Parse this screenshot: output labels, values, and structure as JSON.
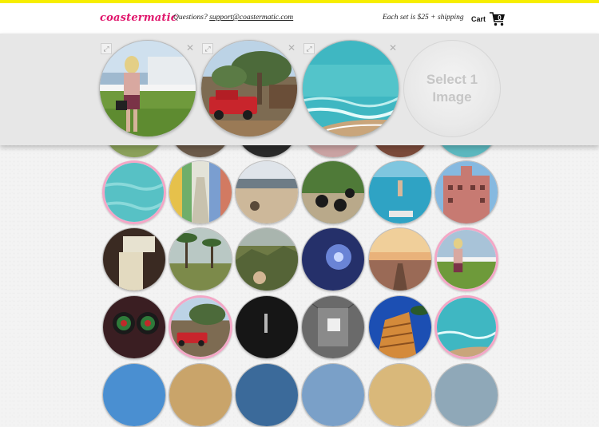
{
  "header": {
    "logo": "coastermatic",
    "questions_label": "Questions?",
    "email": "support@coastermatic.com",
    "pricing": "Each set is $25 + shipping",
    "cart_label": "Cart",
    "cart_count": "0"
  },
  "tray": {
    "empty_slot_text_line1": "Select 1",
    "empty_slot_text_line2": "Image",
    "slots": [
      {
        "image": "girl-by-fence",
        "expand_icon": "expand-icon",
        "remove_icon": "close-icon"
      },
      {
        "image": "red-truck-tree",
        "expand_icon": "expand-icon",
        "remove_icon": "close-icon"
      },
      {
        "image": "turquoise-ocean",
        "expand_icon": "expand-icon",
        "remove_icon": "close-icon"
      }
    ]
  },
  "photos": [
    {
      "image": "turquoise-water",
      "selected": true
    },
    {
      "image": "colorful-buildings",
      "selected": false
    },
    {
      "image": "beach-sand",
      "selected": false
    },
    {
      "image": "segways",
      "selected": false
    },
    {
      "image": "dock-jump",
      "selected": false
    },
    {
      "image": "pink-hotel",
      "selected": false
    },
    {
      "image": "surfboard-room",
      "selected": false
    },
    {
      "image": "palm-park",
      "selected": false
    },
    {
      "image": "hiker-valley",
      "selected": false
    },
    {
      "image": "blue-night",
      "selected": false
    },
    {
      "image": "sunset-pier",
      "selected": false
    },
    {
      "image": "girl-by-fence",
      "selected": true
    },
    {
      "image": "dartboards",
      "selected": false
    },
    {
      "image": "red-truck-tree",
      "selected": true
    },
    {
      "image": "dark-tunnel",
      "selected": false
    },
    {
      "image": "gray-room",
      "selected": false
    },
    {
      "image": "hotel-facade",
      "selected": false
    },
    {
      "image": "turquoise-ocean",
      "selected": true
    }
  ],
  "colors": {
    "accent_yellow": "#f7ee00",
    "logo_pink": "#e0156b",
    "selected_ring": "#f3a7c6"
  }
}
